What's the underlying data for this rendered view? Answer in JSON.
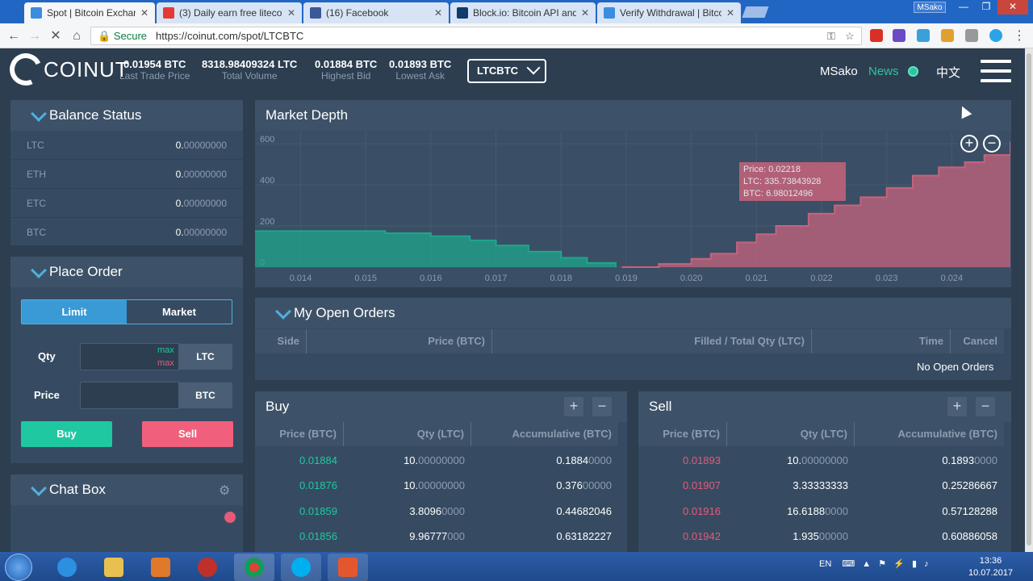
{
  "browser": {
    "tabs": [
      {
        "label": "Spot | Bitcoin Exchange",
        "color": "#3b8de0"
      },
      {
        "label": "(3) Daily earn free liteco",
        "color": "#e53935"
      },
      {
        "label": "(16) Facebook",
        "color": "#3b5998"
      },
      {
        "label": "Block.io: Bitcoin API and",
        "color": "#123a6b"
      },
      {
        "label": "Verify Withdrawal | Bitco",
        "color": "#3b8de0"
      }
    ],
    "user_chip": "MSako",
    "secure_label": "Secure",
    "url": "https://coinut.com/spot/LTCBTC"
  },
  "header": {
    "logo": "COINUT",
    "stats": [
      {
        "value": "0.01954 BTC",
        "label": "Last Trade Price"
      },
      {
        "value": "8318.98409324 LTC",
        "label": "Total Volume"
      },
      {
        "value": "0.01884 BTC",
        "label": "Highest Bid"
      },
      {
        "value": "0.01893 BTC",
        "label": "Lowest Ask"
      }
    ],
    "pair": "LTCBTC",
    "user": "MSako",
    "news": "News",
    "lang": "中文"
  },
  "balance": {
    "title": "Balance Status",
    "rows": [
      {
        "coin": "LTC",
        "int": "0.",
        "frac": "00000000"
      },
      {
        "coin": "ETH",
        "int": "0.",
        "frac": "00000000"
      },
      {
        "coin": "ETC",
        "int": "0.",
        "frac": "00000000"
      },
      {
        "coin": "BTC",
        "int": "0.",
        "frac": "00000000"
      }
    ]
  },
  "order": {
    "title": "Place Order",
    "tab_limit": "Limit",
    "tab_market": "Market",
    "qty_label": "Qty",
    "qty_currency": "LTC",
    "max_label": "max",
    "price_label": "Price",
    "price_currency": "BTC",
    "buy": "Buy",
    "sell": "Sell"
  },
  "chat": {
    "title": "Chat Box"
  },
  "depth": {
    "title": "Market Depth",
    "zoom_in": "+",
    "zoom_out": "−",
    "tooltip": {
      "price": "Price:  0.02218",
      "ltc": "LTC:  335.73843928",
      "btc": "BTC:  6.98012496"
    }
  },
  "chart_data": {
    "type": "area",
    "title": "Market Depth",
    "xlabel": "",
    "ylabel": "",
    "xlim": [
      0.0133,
      0.0249
    ],
    "ylim": [
      0,
      620
    ],
    "x_ticks": [
      0.014,
      0.015,
      0.016,
      0.017,
      0.018,
      0.019,
      0.02,
      0.021,
      0.022,
      0.023,
      0.024
    ],
    "y_ticks": [
      0,
      200,
      400,
      600
    ],
    "grid": true,
    "series": [
      {
        "color": "#1fa58c",
        "x": [
          0.0133,
          0.015,
          0.0153,
          0.016,
          0.0166,
          0.017,
          0.0175,
          0.018,
          0.0184,
          0.01884
        ],
        "y": [
          175,
          175,
          165,
          150,
          130,
          105,
          75,
          45,
          20,
          0
        ]
      },
      {
        "color": "#c6637c",
        "x": [
          0.01893,
          0.0195,
          0.02,
          0.0203,
          0.0207,
          0.021,
          0.0213,
          0.0218,
          0.0222,
          0.0226,
          0.023,
          0.0234,
          0.0238,
          0.0242,
          0.0245,
          0.0249
        ],
        "y": [
          0,
          15,
          40,
          65,
          120,
          160,
          200,
          260,
          300,
          340,
          385,
          445,
          485,
          510,
          545,
          610
        ]
      }
    ]
  },
  "open_orders": {
    "title": "My Open Orders",
    "columns": [
      "Side",
      "Price (BTC)",
      "Filled / Total Qty (LTC)",
      "Time",
      "Cancel"
    ],
    "empty": "No Open Orders"
  },
  "buy": {
    "title": "Buy",
    "columns": [
      "Price (BTC)",
      "Qty (LTC)",
      "Accumulative (BTC)"
    ],
    "rows": [
      {
        "price": "0.01884",
        "qty_a": "10.",
        "qty_b": "00000000",
        "acc_a": "0.1884",
        "acc_b": "0000"
      },
      {
        "price": "0.01876",
        "qty_a": "10.",
        "qty_b": "00000000",
        "acc_a": "0.376",
        "acc_b": "00000"
      },
      {
        "price": "0.01859",
        "qty_a": "3.8096",
        "qty_b": "0000",
        "acc_a": "0.44682046",
        "acc_b": ""
      },
      {
        "price": "0.01856",
        "qty_a": "9.96777",
        "qty_b": "000",
        "acc_a": "0.63182227",
        "acc_b": ""
      }
    ]
  },
  "sell": {
    "title": "Sell",
    "columns": [
      "Price (BTC)",
      "Qty (LTC)",
      "Accumulative (BTC)"
    ],
    "rows": [
      {
        "price": "0.01893",
        "qty_a": "10.",
        "qty_b": "00000000",
        "acc_a": "0.1893",
        "acc_b": "0000"
      },
      {
        "price": "0.01907",
        "qty_a": "3.33333333",
        "qty_b": "",
        "acc_a": "0.25286667",
        "acc_b": ""
      },
      {
        "price": "0.01916",
        "qty_a": "16.6188",
        "qty_b": "0000",
        "acc_a": "0.57128288",
        "acc_b": ""
      },
      {
        "price": "0.01942",
        "qty_a": "1.935",
        "qty_b": "00000",
        "acc_a": "0.60886058",
        "acc_b": ""
      }
    ]
  },
  "taskbar": {
    "lang": "EN",
    "time": "13:36",
    "date": "10.07.2017"
  },
  "colors": {
    "bid": "#1fc8a0",
    "ask": "#e65a7a",
    "accent": "#4fb0e0"
  }
}
